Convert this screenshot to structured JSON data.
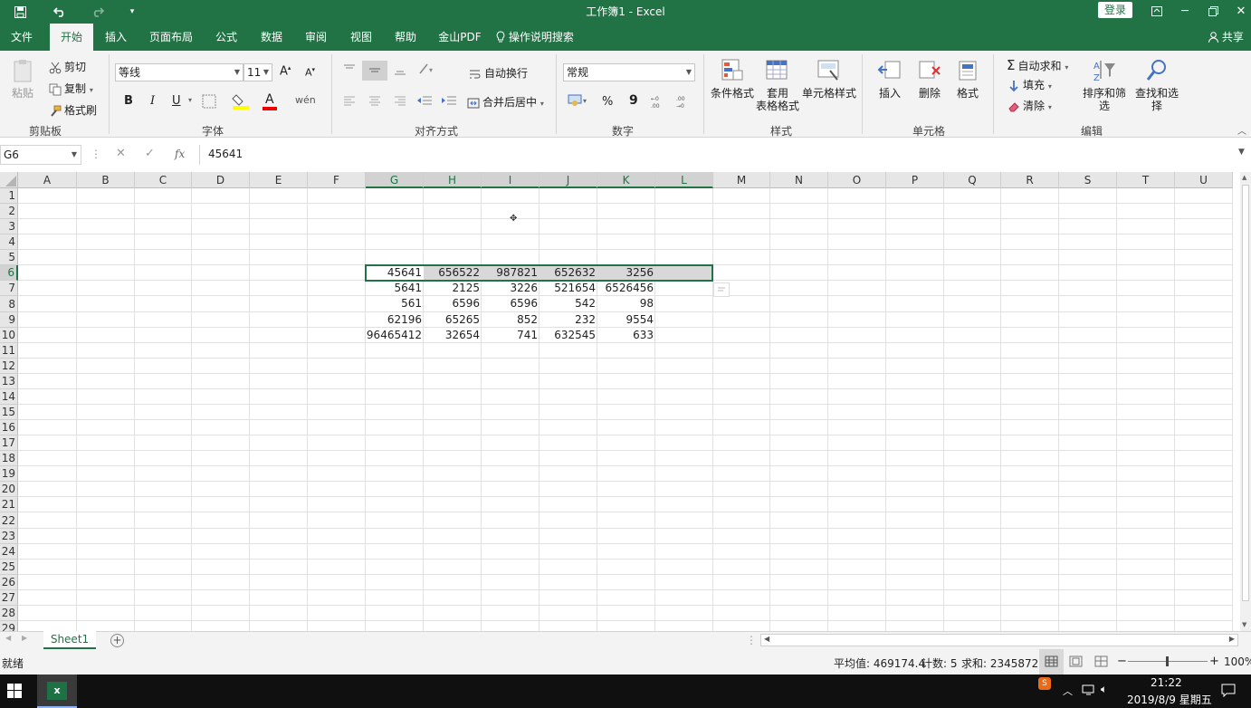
{
  "app": {
    "title": "工作簿1  -  Excel",
    "login_label": "登录",
    "share_label": "共享"
  },
  "tabs": [
    "文件",
    "开始",
    "插入",
    "页面布局",
    "公式",
    "数据",
    "审阅",
    "视图",
    "帮助",
    "金山PDF"
  ],
  "tell_me": "操作说明搜索",
  "ribbon": {
    "clipboard": {
      "paste": "粘贴",
      "cut": "剪切",
      "copy": "复制",
      "format_painter": "格式刷",
      "group": "剪贴板"
    },
    "font": {
      "name": "等线",
      "size": "11",
      "bold": "B",
      "italic": "I",
      "underline": "U",
      "group": "字体"
    },
    "alignment": {
      "wrap": "自动换行",
      "merge": "合并后居中",
      "group": "对齐方式"
    },
    "number": {
      "format": "常规",
      "percent": "%",
      "comma": "9",
      "group": "数字"
    },
    "styles": {
      "conditional": "条件格式",
      "table_line1": "套用",
      "table_line2": "表格格式",
      "cell_styles": "单元格样式",
      "group": "样式"
    },
    "cells": {
      "insert": "插入",
      "delete": "删除",
      "format": "格式",
      "group": "单元格"
    },
    "editing": {
      "autosum": "自动求和",
      "fill": "填充",
      "clear": "清除",
      "sort": "排序和筛选",
      "find": "查找和选择",
      "group": "编辑"
    }
  },
  "formula_bar": {
    "name_box": "G6",
    "fx": "fx",
    "value": "45641"
  },
  "columns": [
    "A",
    "B",
    "C",
    "D",
    "E",
    "F",
    "G",
    "H",
    "I",
    "J",
    "K",
    "L",
    "M",
    "N",
    "O",
    "P",
    "Q",
    "R",
    "S",
    "T",
    "U"
  ],
  "rows": [
    "1",
    "2",
    "3",
    "4",
    "5",
    "6",
    "7",
    "8",
    "9",
    "10",
    "11",
    "12",
    "13",
    "14",
    "15",
    "16",
    "17",
    "18",
    "19",
    "20",
    "21",
    "22",
    "23",
    "24",
    "25",
    "26",
    "27",
    "28",
    "29"
  ],
  "cells": {
    "r6": [
      "45641",
      "656522",
      "987821",
      "652632",
      "3256"
    ],
    "r7": [
      "5641",
      "2125",
      "3226",
      "521654",
      "6526456"
    ],
    "r8": [
      "561",
      "6596",
      "6596",
      "542",
      "98"
    ],
    "r9": [
      "62196",
      "65265",
      "852",
      "232",
      "9554"
    ],
    "r10": [
      "96465412",
      "32654",
      "741",
      "632545",
      "633"
    ]
  },
  "sheets": {
    "active": "Sheet1",
    "add": "+"
  },
  "status": {
    "mode": "就绪",
    "average": "平均值: 469174.4",
    "count": "计数: 5",
    "sum": "求和: 2345872",
    "zoom": "100%"
  },
  "taskbar": {
    "time": "21:22",
    "date": "2019/8/9 星期五"
  },
  "colors": {
    "accent": "#217346"
  }
}
